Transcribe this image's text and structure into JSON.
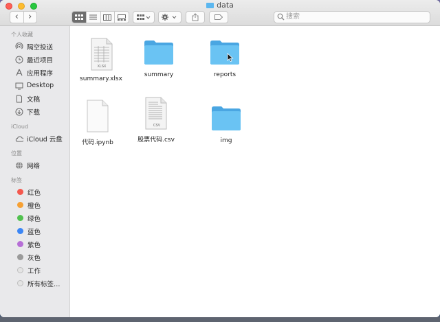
{
  "window": {
    "title": "data"
  },
  "toolbar": {
    "back": "‹",
    "forward": "›",
    "search_placeholder": "搜索"
  },
  "sidebar": {
    "favorites_title": "个人收藏",
    "favorites": [
      {
        "label": "隔空投送",
        "icon": "airdrop-icon"
      },
      {
        "label": "最近项目",
        "icon": "clock-icon"
      },
      {
        "label": "应用程序",
        "icon": "applications-icon"
      },
      {
        "label": "Desktop",
        "icon": "desktop-icon"
      },
      {
        "label": "文稿",
        "icon": "document-icon"
      },
      {
        "label": "下载",
        "icon": "download-icon"
      }
    ],
    "icloud_title": "iCloud",
    "icloud": [
      {
        "label": "iCloud 云盘",
        "icon": "cloud-icon"
      }
    ],
    "locations_title": "位置",
    "locations": [
      {
        "label": "网络",
        "icon": "network-icon"
      }
    ],
    "tags_title": "标签",
    "tags": [
      {
        "label": "红色",
        "color": "#f4584e"
      },
      {
        "label": "橙色",
        "color": "#f6a033"
      },
      {
        "label": "绿色",
        "color": "#51c14f"
      },
      {
        "label": "蓝色",
        "color": "#3b86f5"
      },
      {
        "label": "紫色",
        "color": "#b66ed6"
      },
      {
        "label": "灰色",
        "color": "#9a9a9a"
      },
      {
        "label": "工作",
        "color": "#e4e4e4"
      },
      {
        "label": "所有标签…",
        "color": "#e4e4e4"
      }
    ]
  },
  "files": [
    {
      "name": "summary.xlsx",
      "kind": "xlsx-file-icon",
      "badge": "XLSX"
    },
    {
      "name": "summary",
      "kind": "folder-icon"
    },
    {
      "name": "reports",
      "kind": "folder-icon"
    },
    {
      "name": "代码.ipynb",
      "kind": "blank-file-icon"
    },
    {
      "name": "股票代码.csv",
      "kind": "csv-file-icon",
      "badge": "CSV"
    },
    {
      "name": "img",
      "kind": "folder-icon"
    }
  ],
  "colors": {
    "folder": "#5cb7ef",
    "folder_dark": "#4aa6e2",
    "sidebar": "#e9e9eb"
  }
}
